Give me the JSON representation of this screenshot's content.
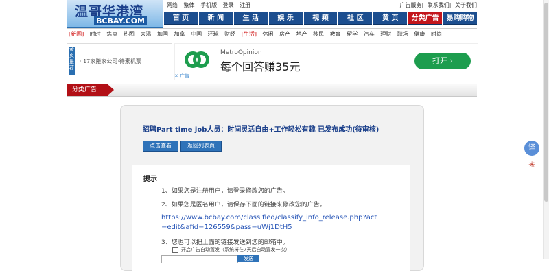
{
  "header": {
    "logo_text": "温哥华港湾",
    "logo_sub": "BCBAY.COM",
    "top_links": [
      "网络",
      "繁体",
      "手机版",
      "登录",
      "注册"
    ],
    "right_links": [
      "广告服务",
      "联系我们",
      "关于我们"
    ]
  },
  "main_nav": [
    "首 页",
    "新 闻",
    "生 活",
    "娱 乐",
    "视 频",
    "社 区",
    "黄 页",
    "分类广告",
    "易购购物"
  ],
  "sub_nav": [
    "[新闻]",
    "时时",
    "焦点",
    "热图",
    "大温",
    "加国",
    "加拿",
    "中国",
    "环球",
    "财经",
    "[生活]",
    "休闲",
    "房产",
    "地产",
    "移民",
    "教育",
    "留学",
    "汽车",
    "理财",
    "职场",
    "健康",
    "时尚"
  ],
  "ad_left": {
    "tag": "黄页推荐",
    "text": "· 17家搬家公司·待素机票"
  },
  "ad_banner": {
    "brand": "MetroOpinion",
    "slogan": "每个回答赚35元",
    "open_label": "打开 ›",
    "close": "✕ 广告"
  },
  "section": {
    "tag": "分类广告"
  },
  "panel": {
    "title": "招聘Part time job人员：时间灵活自由+工作轻松有趣 已发布成功(待审核)",
    "view_button": "点击查看",
    "back_button": "返回列表页"
  },
  "notice": {
    "heading": "提示",
    "items": [
      "1、如果您是注册用户，请登录修改您的广告。",
      "2、如果您是匿名用户，请保存下面的链接来修改您的广告。",
      "3、您也可以把上面的链接发送到您的邮箱中。"
    ],
    "link": "https://www.bcbay.com/classified/classify_info_release.php?act=edit&afid=126559&pass=uWj1DtH5",
    "checkbox_label": "开启广告自动置发（系统将在7天后自动置发一次）",
    "send_label": "发送"
  },
  "widgets": {
    "translate_icon": "译"
  }
}
